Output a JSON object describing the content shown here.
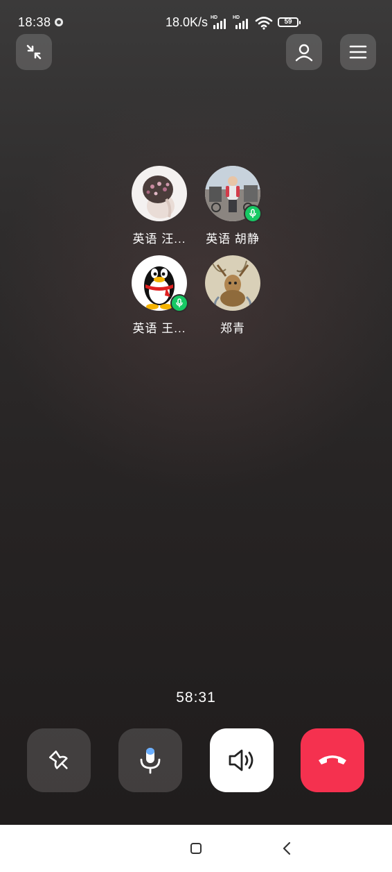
{
  "status_bar": {
    "time": "18:38",
    "net_speed": "18.0K/s",
    "signal_badge": "HD",
    "battery": "59"
  },
  "top_buttons": {
    "minimize_icon": "minimize-arrows-icon",
    "add_member_icon": "person-icon",
    "menu_icon": "hamburger-menu-icon"
  },
  "participants": [
    {
      "name": "英语 汪...",
      "speaking": false
    },
    {
      "name": "英语 胡静",
      "speaking": true
    },
    {
      "name": "英语 王...",
      "speaking": true
    },
    {
      "name": "郑青",
      "speaking": false
    }
  ],
  "call": {
    "duration": "58:31"
  },
  "controls": [
    {
      "icon": "pin-icon",
      "style": "dark"
    },
    {
      "icon": "microphone-icon",
      "style": "dark"
    },
    {
      "icon": "speaker-icon",
      "style": "white"
    },
    {
      "icon": "hang-up-icon",
      "style": "red"
    }
  ],
  "colors": {
    "hang_up": "#f5314f",
    "speaking_badge": "#17c964",
    "mic_accent": "#2f8cff"
  }
}
